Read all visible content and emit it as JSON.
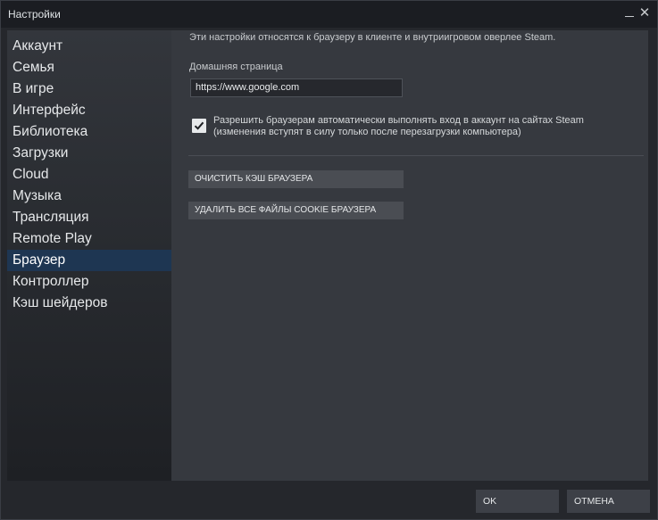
{
  "window": {
    "title": "Настройки",
    "minimize_icon": "minimize-icon",
    "close_icon": "close-icon",
    "close_glyph": "✕"
  },
  "sidebar": {
    "items": [
      {
        "label": "Аккаунт"
      },
      {
        "label": "Семья"
      },
      {
        "label": "В игре"
      },
      {
        "label": "Интерфейс"
      },
      {
        "label": "Библиотека"
      },
      {
        "label": "Загрузки"
      },
      {
        "label": "Cloud"
      },
      {
        "label": "Музыка"
      },
      {
        "label": "Трансляция"
      },
      {
        "label": "Remote Play"
      },
      {
        "label": "Браузер",
        "active": true
      },
      {
        "label": "Контроллер"
      },
      {
        "label": "Кэш шейдеров"
      }
    ]
  },
  "browser": {
    "description": "Эти настройки относятся к браузеру в клиенте и внутриигровом оверлее Steam.",
    "home_label": "Домашняя страница",
    "home_value": "https://www.google.com",
    "auto_login_checked": true,
    "auto_login_line1": "Разрешить браузерам автоматически выполнять вход в аккаунт на сайтах Steam",
    "auto_login_line2": "(изменения вступят в силу только после перезагрузки компьютера)",
    "clear_cache_label": "ОЧИСТИТЬ КЭШ БРАУЗЕРА",
    "delete_cookies_label": "УДАЛИТЬ ВСЕ ФАЙЛЫ COOKIE БРАУЗЕРА"
  },
  "footer": {
    "ok_label": "OK",
    "cancel_label": "ОТМЕНА"
  },
  "colors": {
    "active_nav": "#1e3652",
    "content_bg": "#36393f",
    "titlebar_bg": "#1b1d22"
  }
}
